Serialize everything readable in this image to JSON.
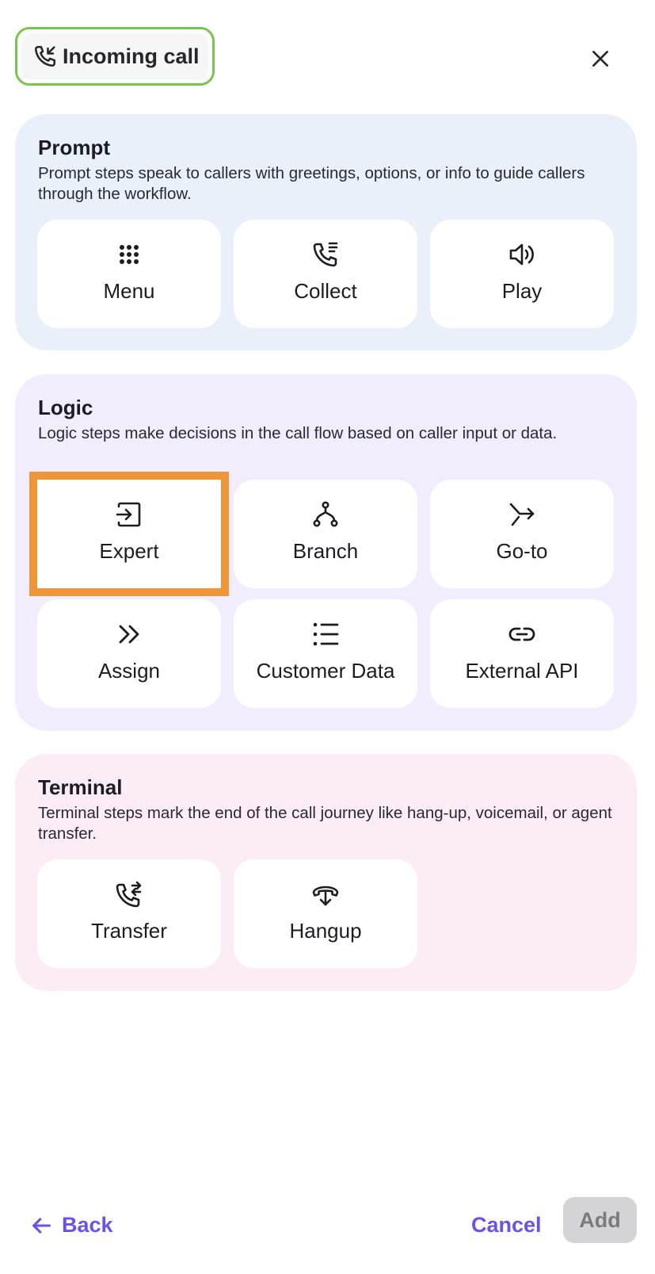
{
  "header": {
    "trigger_label": "Incoming call",
    "trigger_icon": "phone-incoming-icon",
    "close_icon": "close-icon",
    "trigger_border_color": "#7ac34f"
  },
  "sections": [
    {
      "title": "Prompt",
      "description": "Prompt steps speak to callers with greetings, options, or info to guide callers through the workflow.",
      "background": "#eaf0f9",
      "items": [
        {
          "label": "Menu",
          "icon": "dialpad-icon"
        },
        {
          "label": "Collect",
          "icon": "phone-list-icon"
        },
        {
          "label": "Play",
          "icon": "speaker-icon"
        }
      ]
    },
    {
      "title": "Logic",
      "description": "Logic steps make decisions in the call flow based on caller input or data.",
      "background": "#f1edfc",
      "items": [
        {
          "label": "Expert",
          "icon": "enter-box-icon",
          "selected": true
        },
        {
          "label": "Branch",
          "icon": "branch-icon"
        },
        {
          "label": "Go-to",
          "icon": "goto-arrow-icon"
        },
        {
          "label": "Assign",
          "icon": "double-chevron-right-icon"
        },
        {
          "label": "Customer Data",
          "icon": "list-icon"
        },
        {
          "label": "External API",
          "icon": "link-icon"
        }
      ]
    },
    {
      "title": "Terminal",
      "description": "Terminal steps mark the end of the call journey like hang-up, voicemail, or agent transfer.",
      "background": "#fbecf6",
      "items": [
        {
          "label": "Transfer",
          "icon": "phone-transfer-icon"
        },
        {
          "label": "Hangup",
          "icon": "hangup-icon"
        }
      ]
    }
  ],
  "footer": {
    "back_label": "Back",
    "back_icon": "arrow-left-icon",
    "cancel_label": "Cancel",
    "add_label": "Add",
    "add_disabled": true,
    "accent_color": "#6b52e6"
  },
  "selection_color": "#ee9537"
}
